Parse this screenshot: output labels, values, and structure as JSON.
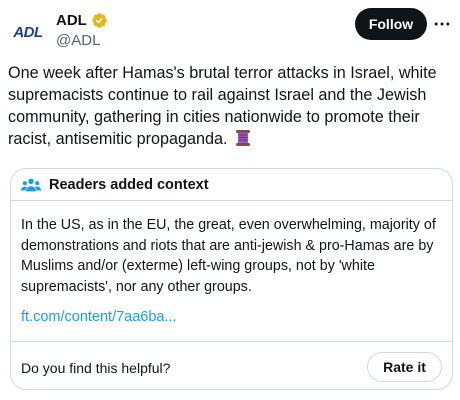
{
  "author": {
    "avatar_text": "ADL",
    "display_name": "ADL",
    "handle": "@ADL",
    "verified_badge_color": "#e2b719"
  },
  "actions": {
    "follow_label": "Follow",
    "more_icon": "more-horizontal-icon"
  },
  "tweet": {
    "text": "One week after Hamas's brutal terror attacks in Israel, white supremacists continue to rail against Israel and the Jewish community, gathering in cities nationwide to promote their racist, antisemitic propaganda.",
    "emoji": "scroll-icon"
  },
  "community_note": {
    "title": "Readers added context",
    "icon": "people-icon",
    "body": "In the US, as in the EU, the great, even overwhelming, majority of demonstrations and riots that are anti-jewish & pro-Hamas are by Muslims and/or (exterme) left-wing groups, not by 'white supremacists', nor any other groups.",
    "link_text": "ft.com/content/7aa6ba...",
    "helpful_question": "Do you find this helpful?",
    "rate_label": "Rate it"
  },
  "colors": {
    "text": "#0f1419",
    "secondary_text": "#536471",
    "link": "#1d9bf0",
    "border": "#cfd9de",
    "follow_bg": "#0f1419",
    "brand": "#1c3f94"
  }
}
